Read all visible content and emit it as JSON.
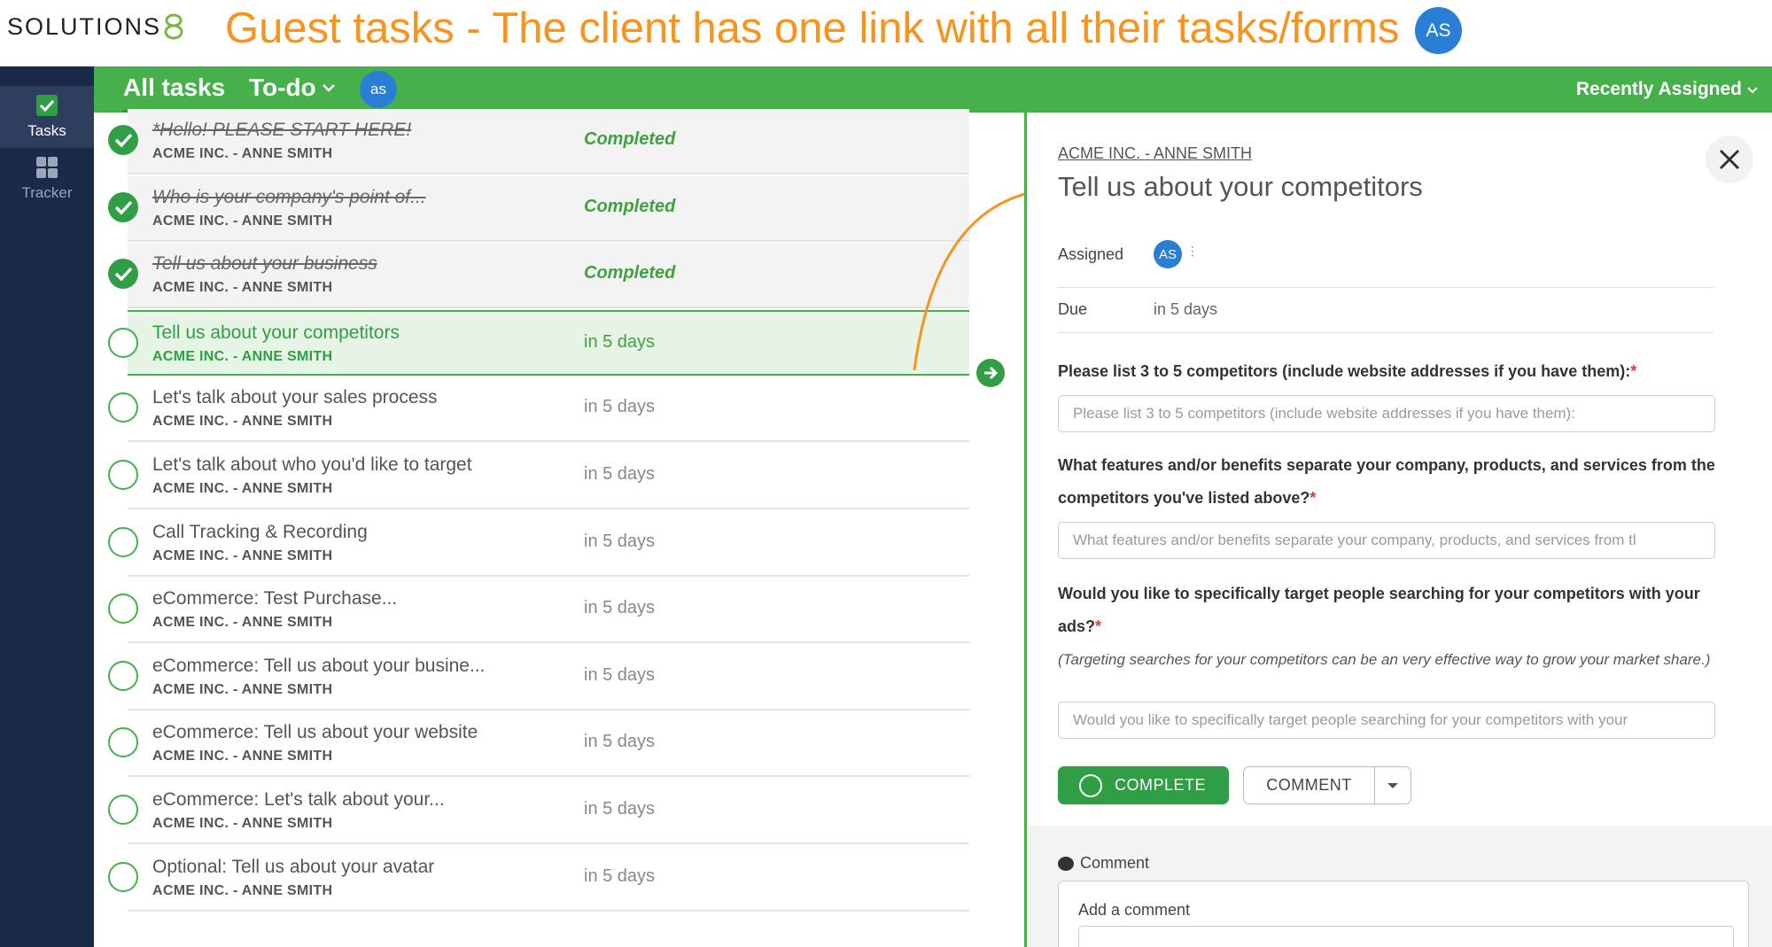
{
  "banner": {
    "logo_text": "SOLUTIONS",
    "headline": "Guest tasks - The client has one link with all their tasks/forms",
    "avatar_initials": "AS"
  },
  "leftnav": {
    "items": [
      {
        "label": "Tasks",
        "icon": "checkbox-icon",
        "active": true
      },
      {
        "label": "Tracker",
        "icon": "grid-icon",
        "active": false
      }
    ]
  },
  "topbar": {
    "all_tasks": "All tasks",
    "todo": "To-do",
    "avatar_initials": "as",
    "sort": "Recently Assigned"
  },
  "tasks": [
    {
      "title": "*Hello! PLEASE START HERE!",
      "client": "ACME INC. - ANNE SMITH",
      "status": "Completed",
      "done": true
    },
    {
      "title": "Who is your company's point of...",
      "client": "ACME INC. - ANNE SMITH",
      "status": "Completed",
      "done": true
    },
    {
      "title": "Tell us about your business",
      "client": "ACME INC. - ANNE SMITH",
      "status": "Completed",
      "done": true
    },
    {
      "title": "Tell us about your competitors",
      "client": "ACME INC. - ANNE SMITH",
      "status": "in 5 days",
      "done": false,
      "selected": true
    },
    {
      "title": "Let's talk about your sales process",
      "client": "ACME INC. - ANNE SMITH",
      "status": "in 5 days",
      "done": false
    },
    {
      "title": "Let's talk about who you'd like to target",
      "client": "ACME INC. - ANNE SMITH",
      "status": "in 5 days",
      "done": false
    },
    {
      "title": "Call Tracking & Recording",
      "client": "ACME INC. - ANNE SMITH",
      "status": "in 5 days",
      "done": false
    },
    {
      "title": "eCommerce: Test Purchase...",
      "client": "ACME INC. - ANNE SMITH",
      "status": "in 5 days",
      "done": false
    },
    {
      "title": "eCommerce: Tell us about your busine...",
      "client": "ACME INC. - ANNE SMITH",
      "status": "in 5 days",
      "done": false
    },
    {
      "title": "eCommerce: Tell us about your website",
      "client": "ACME INC. - ANNE SMITH",
      "status": "in 5 days",
      "done": false
    },
    {
      "title": "eCommerce: Let's talk about your...",
      "client": "ACME INC. - ANNE SMITH",
      "status": "in 5 days",
      "done": false
    },
    {
      "title": "Optional: Tell us about your avatar",
      "client": "ACME INC. - ANNE SMITH",
      "status": "in 5 days",
      "done": false
    }
  ],
  "panel": {
    "client": "ACME INC. - ANNE SMITH",
    "title": "Tell us about your competitors",
    "assigned_label": "Assigned",
    "assigned_initials": "AS",
    "due_label": "Due",
    "due_value": "in 5 days",
    "q1": "Please list 3 to 5 competitors (include website addresses if you have them):",
    "q1_placeholder": "Please list 3 to 5 competitors (include website addresses if you have them):",
    "q2": "What features and/or benefits separate your company, products, and services from the competitors you've listed above?",
    "q2_placeholder": "What features and/or benefits separate your company, products, and services from tl",
    "q3": "Would you like to specifically target people searching for your competitors with your ads?",
    "q3_note": "(Targeting searches for your competitors can be an very effective way to grow your market share.)",
    "q3_placeholder": "Would you like to specifically target people searching for your competitors with your",
    "required_mark": "*",
    "complete_label": "COMPLETE",
    "comment_label": "COMMENT",
    "comment_section": "Comment",
    "add_comment": "Add a comment"
  },
  "colors": {
    "brand_green": "#46b04a",
    "nav_dark": "#1b2a48",
    "headline_orange": "#f7941d",
    "avatar_blue": "#2a7fd4"
  }
}
